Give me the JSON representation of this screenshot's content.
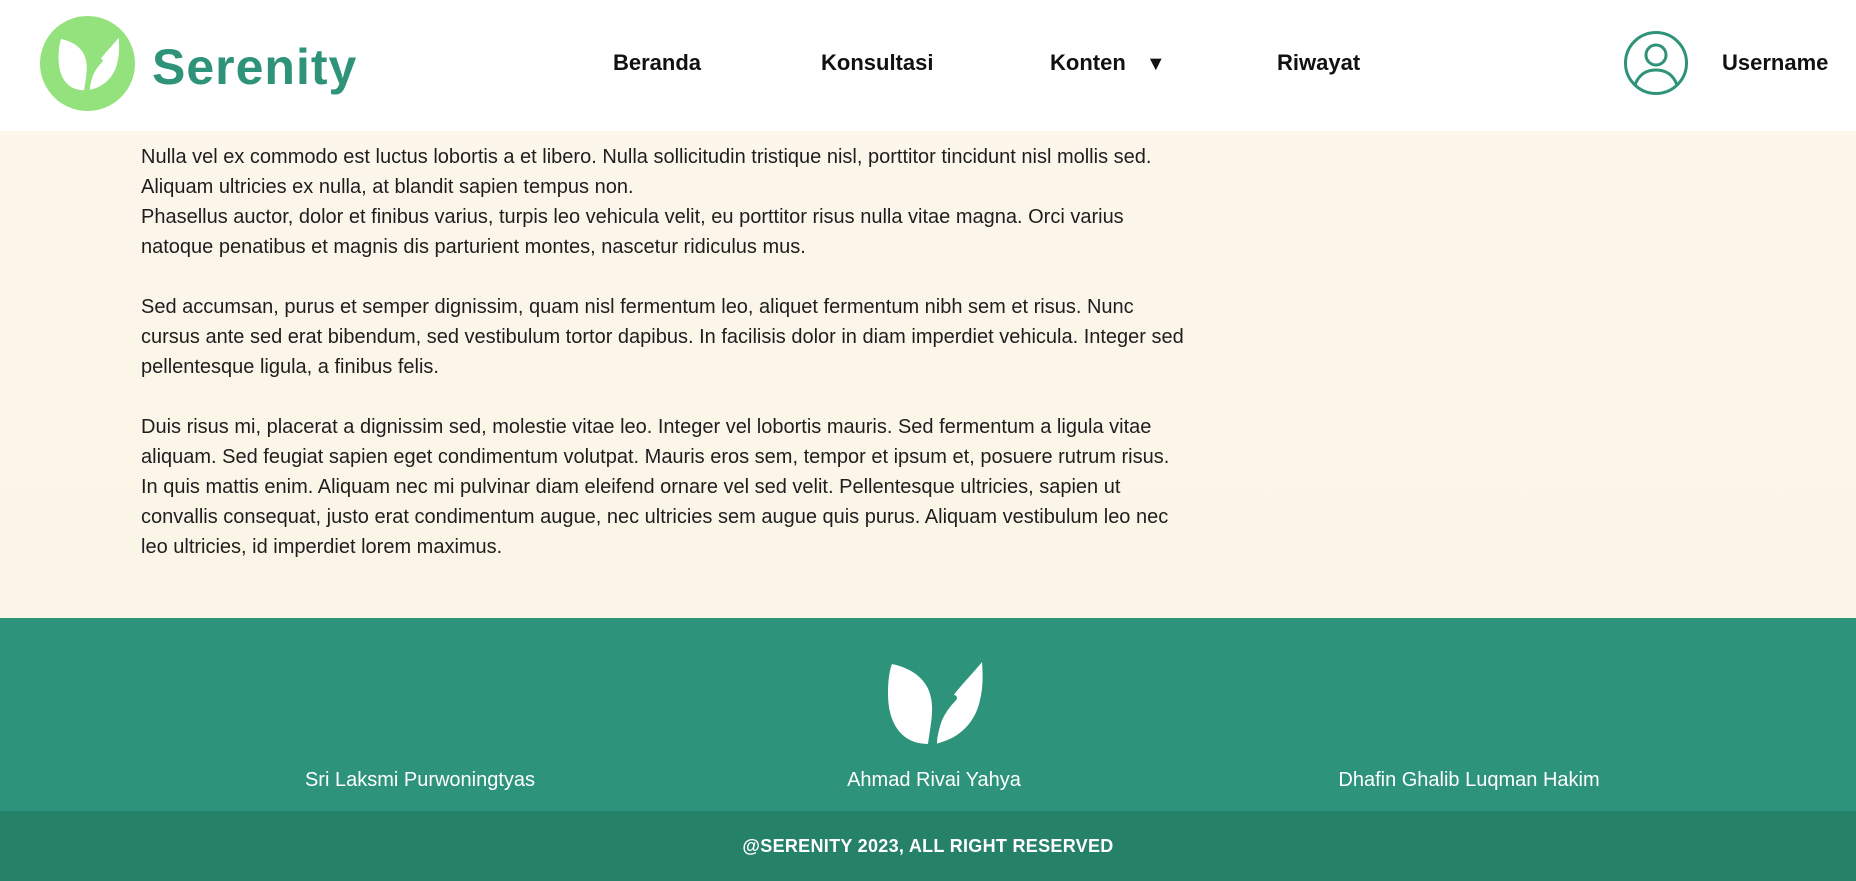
{
  "header": {
    "brand": "Serenity",
    "nav": [
      {
        "label": "Beranda"
      },
      {
        "label": "Konsultasi"
      },
      {
        "label": "Konten"
      },
      {
        "label": "Riwayat"
      }
    ],
    "dropdown_caret": "▼",
    "username": "Username"
  },
  "article": {
    "paragraphs": [
      "Nulla vel ex commodo est luctus lobortis a et libero. Nulla sollicitudin tristique nisl, porttitor tincidunt nisl mollis sed. Aliquam ultricies ex nulla, at blandit sapien tempus non.",
      "Phasellus auctor, dolor et finibus varius, turpis leo vehicula velit, eu porttitor risus nulla vitae magna. Orci varius natoque penatibus et magnis dis parturient montes, nascetur ridiculus mus.",
      "Sed accumsan, purus et semper dignissim, quam nisl fermentum leo, aliquet fermentum nibh sem et risus. Nunc cursus ante sed erat bibendum, sed vestibulum tortor dapibus. In facilisis dolor in diam imperdiet vehicula. Integer sed pellentesque ligula, a finibus felis.",
      "Duis risus mi, placerat a dignissim sed, molestie vitae leo. Integer vel lobortis mauris. Sed fermentum a ligula vitae aliquam. Sed feugiat sapien eget condimentum volutpat. Mauris eros sem, tempor et ipsum et, posuere rutrum risus. In quis mattis enim. Aliquam nec mi pulvinar diam eleifend ornare vel sed velit. Pellentesque ultricies, sapien ut convallis consequat, justo erat condimentum augue, nec ultricies sem augue quis purus. Aliquam vestibulum leo nec leo ultricies, id imperdiet lorem maximus."
    ]
  },
  "footer": {
    "members": [
      "Sri Laksmi Purwoningtyas",
      "Ahmad Rivai Yahya",
      "Dhafin Ghalib Luqman Hakim"
    ],
    "copyright": "@SERENITY 2023, ALL RIGHT RESERVED"
  },
  "colors": {
    "brand_green": "#2e9379",
    "logo_circle": "#93e27d",
    "footer_bg": "#2d937b",
    "copyright_bg": "#268169",
    "content_bg": "#fbf6ea"
  },
  "icons": {
    "logo": "leaf-icon",
    "user": "user-circle-icon",
    "dropdown": "caret-down-icon"
  }
}
